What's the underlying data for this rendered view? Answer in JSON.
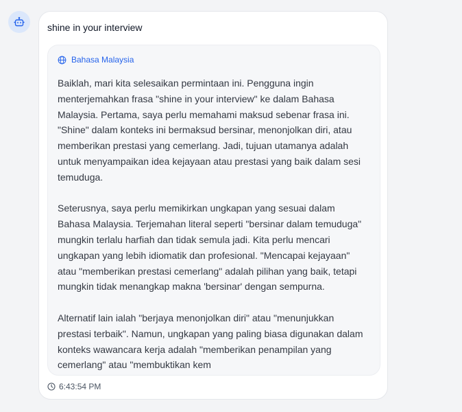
{
  "message": {
    "avatar_icon": "bot-icon",
    "prompt": "shine in your interview",
    "translation": {
      "language_icon": "globe-icon",
      "language": "Bahasa Malaysia",
      "paragraphs": [
        "Baiklah, mari kita selesaikan permintaan ini. Pengguna ingin menterjemahkan frasa \"shine in your interview\" ke dalam Bahasa Malaysia. Pertama, saya perlu memahami maksud sebenar frasa ini. \"Shine\" dalam konteks ini bermaksud bersinar, menonjolkan diri, atau memberikan prestasi yang cemerlang. Jadi, tujuan utamanya adalah untuk menyampaikan idea kejayaan atau prestasi yang baik dalam sesi temuduga.",
        "Seterusnya, saya perlu memikirkan ungkapan yang sesuai dalam Bahasa Malaysia. Terjemahan literal seperti \"bersinar dalam temuduga\" mungkin terlalu harfiah dan tidak semula jadi. Kita perlu mencari ungkapan yang lebih idiomatik dan profesional. \"Mencapai kejayaan\" atau \"memberikan prestasi cemerlang\" adalah pilihan yang baik, tetapi mungkin tidak menangkap makna 'bersinar' dengan sempurna.",
        "Alternatif lain ialah \"berjaya menonjolkan diri\" atau \"menunjukkan prestasi terbaik\". Namun, ungkapan yang paling biasa digunakan dalam konteks wawancara kerja adalah \"memberikan penampilan yang cemerlang\" atau \"membuktikan kem"
      ]
    },
    "time_icon": "clock-icon",
    "timestamp": "6:43:54 PM"
  },
  "colors": {
    "accent": "#2563eb",
    "avatar_bg": "#dbe7fb",
    "page_bg": "#f3f4f6"
  }
}
